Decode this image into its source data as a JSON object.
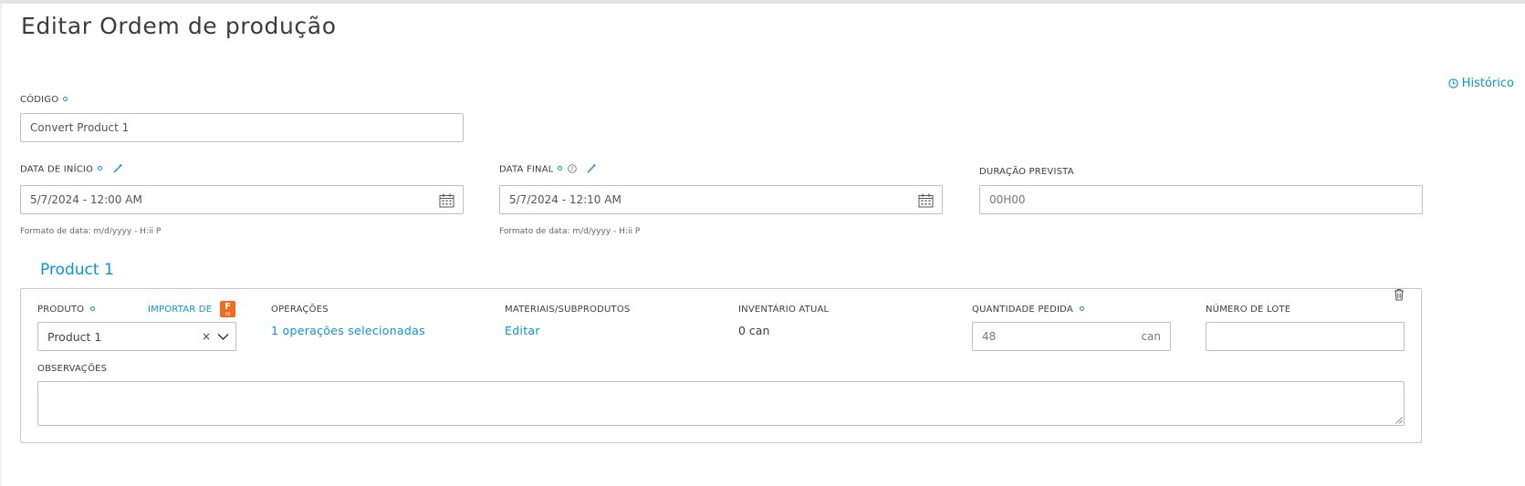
{
  "page": {
    "title": "Editar Ordem de produção"
  },
  "history_link": {
    "label": "Histórico"
  },
  "code": {
    "label": "CÓDIGO",
    "value": "Convert Product 1"
  },
  "start_date": {
    "label": "DATA DE INÍCIO",
    "value": "5/7/2024 - 12:00 AM",
    "hint": "Formato de data: m/d/yyyy - H:ii P"
  },
  "end_date": {
    "label": "DATA FINAL",
    "value": "5/7/2024 - 12:10 AM",
    "hint": "Formato de data: m/d/yyyy - H:ii P"
  },
  "duration": {
    "label": "DURAÇÃO PREVISTA",
    "value": "00H00"
  },
  "product_block": {
    "title": "Product 1",
    "product": {
      "label": "PRODUTO",
      "value": "Product 1"
    },
    "import": {
      "label": "IMPORTAR DE",
      "badge_text": "F",
      "badge_subtext": "FM"
    },
    "operations": {
      "label": "OPERAÇÕES",
      "link": "1 operações selecionadas"
    },
    "materials": {
      "label": "MATERIAIS/SUBPRODUTOS",
      "link": "Editar"
    },
    "inventory": {
      "label": "INVENTÁRIO ATUAL",
      "value": "0 can"
    },
    "quantity": {
      "label": "QUANTIDADE PEDIDA",
      "value": "48",
      "unit": "can"
    },
    "lot": {
      "label": "NÚMERO DE LOTE",
      "value": ""
    },
    "notes": {
      "label": "OBSERVAÇÕES",
      "value": ""
    }
  },
  "colors": {
    "accent": "#0696d7",
    "text": "#3c3c3c",
    "border": "#bfbfbf",
    "badge": "#f26b21"
  },
  "icons": [
    "clock-icon",
    "required-dot-icon",
    "magic-wand-icon",
    "help-icon",
    "calendar-icon",
    "clear-icon",
    "chevron-down-icon",
    "trash-icon",
    "resize-grip-icon"
  ]
}
